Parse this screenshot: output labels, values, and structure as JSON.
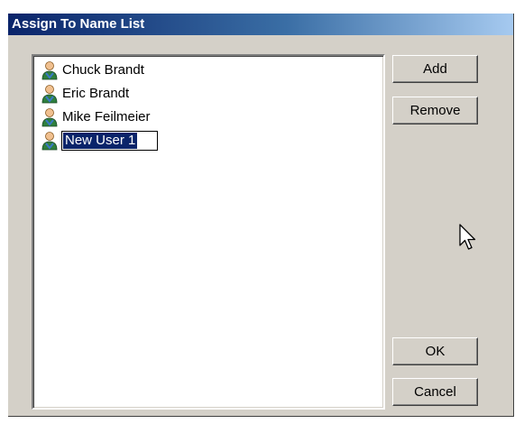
{
  "window": {
    "title": "Assign To Name List"
  },
  "name_list": {
    "items": [
      {
        "label": "Chuck Brandt",
        "icon": "user-icon"
      },
      {
        "label": "Eric Brandt",
        "icon": "user-icon"
      },
      {
        "label": "Mike Feilmeier",
        "icon": "user-icon"
      },
      {
        "label": "New User 1",
        "icon": "user-icon",
        "editing": true
      }
    ]
  },
  "buttons": {
    "add": "Add",
    "remove": "Remove",
    "ok": "OK",
    "cancel": "Cancel"
  },
  "colors": {
    "titlebar_start": "#0a246a",
    "titlebar_end": "#a6caf0",
    "selection": "#0a246a",
    "face": "#d4d0c8"
  }
}
